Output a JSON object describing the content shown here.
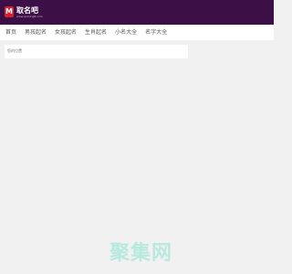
{
  "header": {
    "logo_mark": "M",
    "logo_name": "取名吧",
    "logo_sub": "www.quming8.com",
    "background": "#3c0f46"
  },
  "nav": {
    "items": [
      {
        "label": "首页"
      },
      {
        "label": "男孩起名"
      },
      {
        "label": "女孩起名"
      },
      {
        "label": "生肖起名"
      },
      {
        "label": "小名大全"
      },
      {
        "label": "名字大全"
      }
    ]
  },
  "content": {
    "breadcrumb": "您的位置"
  },
  "watermark": {
    "text": "聚集网"
  }
}
